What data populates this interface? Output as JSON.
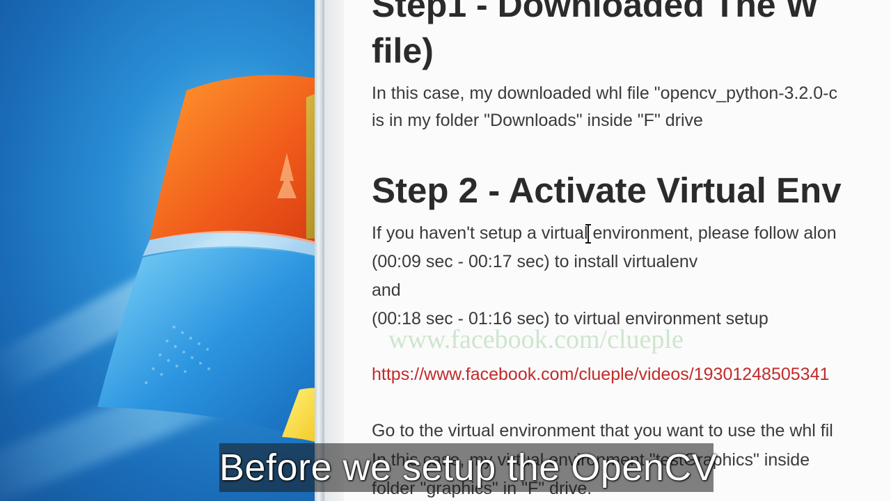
{
  "article": {
    "step1_heading_line1": "Step1 - Downloaded The W",
    "step1_heading_line2": "file)",
    "step1_text_line1": "In this case, my downloaded whl file \"opencv_python-3.2.0-c",
    "step1_text_line2": "is in my folder \"Downloads\" inside \"F\" drive",
    "step2_heading": "Step 2 - Activate Virtual Env",
    "step2_text_line1": "If you haven't setup a virtual environment, please follow alon",
    "step2_text_line2": "(00:09 sec - 00:17 sec) to install virtualenv",
    "step2_text_line3": "and",
    "step2_text_line4": "(00:18 sec - 01:16 sec) to virtual environment setup",
    "video_link": "https://www.facebook.com/clueple/videos/19301248505341",
    "step3_text_line1": "Go to the virtual environment that you want to use the whl fil",
    "step3_text_line2": "In this case, my virtual environment \"testGraphics\" inside",
    "step3_text_line3": "folder \"graphics\" in \"F\" drive."
  },
  "watermark": "www.facebook.com/clueple",
  "caption": "Before we setup the OpenCV",
  "colors": {
    "link": "#c22a2a",
    "heading": "#2b2b2b",
    "body_text": "#3a3a3a"
  }
}
